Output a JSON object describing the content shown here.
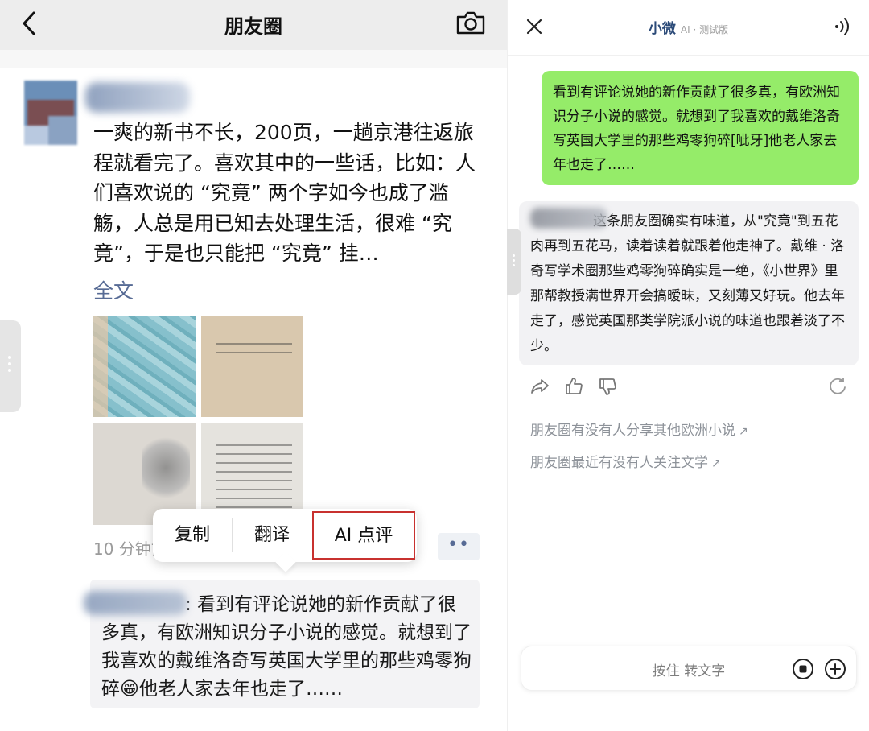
{
  "left": {
    "nav": {
      "title": "朋友圈"
    },
    "post": {
      "text": "一爽的新书不长，200页，一趟京港往返旅程就看完了。喜欢其中的一些话，比如：人们喜欢说的 “究竟” 两个字如今也成了滥觞，人总是用已知去处理生活，很难 “究竟”，于是也只能把 “究竟” 挂…",
      "fulltext_link": "全文",
      "time": "10 分钟前",
      "more_button": "••"
    },
    "popup_menu": {
      "items": [
        "复制",
        "翻译",
        "AI 点评"
      ]
    },
    "comment": {
      "text": ": 看到有评论说她的新作贡献了很多真，有欧洲知识分子小说的感觉。就想到了我喜欢的戴维洛奇写英国大学里的那些鸡零狗碎😁他老人家去年也走了……"
    }
  },
  "right": {
    "header": {
      "title": "小微",
      "subtitle": "AI · 测试版"
    },
    "user_message": "看到有评论说她的新作贡献了很多真，有欧洲知识分子小说的感觉。就想到了我喜欢的戴维洛奇写英国大学里的那些鸡零狗碎[呲牙]他老人家去年也走了……",
    "ai_message": "这条朋友圈确实有味道，从\"究竟\"到五花肉再到五花马，读着读着就跟着他走神了。戴维 · 洛奇写学术圈那些鸡零狗碎确实是一绝，《小世界》里那帮教授满世界开会搞暧昧，又刻薄又好玩。他去年走了，感觉英国那类学院派小说的味道也跟着淡了不少。",
    "suggestions": [
      "朋友圈有没有人分享其他欧洲小说",
      "朋友圈最近有没有人关注文学"
    ],
    "suggestion_arrow": "↗",
    "input": {
      "placeholder": "按住 转文字"
    }
  },
  "colors": {
    "link_blue": "#576b95",
    "user_bubble_green": "#95ec69",
    "highlight_red": "#c8312f",
    "title_navy": "#2b4a78"
  },
  "icons": [
    "back-icon",
    "camera-icon",
    "close-icon",
    "sound-icon",
    "share-icon",
    "thumbs-up-icon",
    "thumbs-down-icon",
    "refresh-icon",
    "stop-icon",
    "plus-icon"
  ]
}
